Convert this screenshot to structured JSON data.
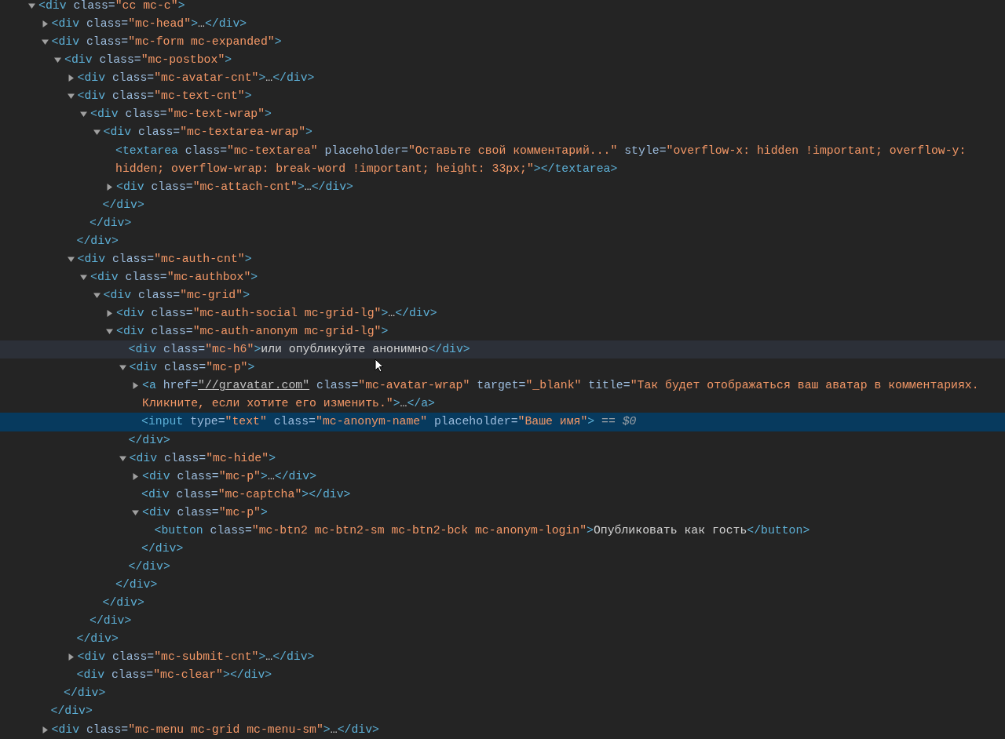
{
  "elements_tree": {
    "kind": "toggle",
    "expanded": true,
    "selected": false,
    "hovered": false,
    "line": "<div class=\"cc mc-c\">",
    "children": [
      {
        "kind": "toggle",
        "expanded": false,
        "selected": false,
        "hovered": false,
        "line": "<div class=\"mc-head\">…</div>"
      },
      {
        "kind": "toggle",
        "expanded": true,
        "selected": false,
        "hovered": false,
        "line": "<div class=\"mc-form mc-expanded\">",
        "close": "</div>",
        "children": [
          {
            "kind": "toggle",
            "expanded": true,
            "selected": false,
            "hovered": false,
            "line": "<div class=\"mc-postbox\">",
            "close": "</div>",
            "children": [
              {
                "kind": "toggle",
                "expanded": false,
                "selected": false,
                "hovered": false,
                "line": "<div class=\"mc-avatar-cnt\">…</div>"
              },
              {
                "kind": "toggle",
                "expanded": true,
                "selected": false,
                "hovered": false,
                "line": "<div class=\"mc-text-cnt\">",
                "close": "</div>",
                "children": [
                  {
                    "kind": "toggle",
                    "expanded": true,
                    "selected": false,
                    "hovered": false,
                    "line": "<div class=\"mc-text-wrap\">",
                    "close": "</div>",
                    "children": [
                      {
                        "kind": "toggle",
                        "expanded": true,
                        "selected": false,
                        "hovered": false,
                        "line": "<div class=\"mc-textarea-wrap\">",
                        "close": "</div>",
                        "children": [
                          {
                            "kind": "leaf",
                            "selected": false,
                            "hovered": false,
                            "line": "<textarea class=\"mc-textarea\" placeholder=\"Оставьте свой комментарий...\" style=\"overflow-x: hidden !important; overflow-y: hidden; overflow-wrap: break-word !important; height: 33px;\"></textarea>"
                          },
                          {
                            "kind": "toggle",
                            "expanded": false,
                            "selected": false,
                            "hovered": false,
                            "line": "<div class=\"mc-attach-cnt\">…</div>"
                          }
                        ]
                      }
                    ]
                  }
                ]
              },
              {
                "kind": "toggle",
                "expanded": true,
                "selected": false,
                "hovered": false,
                "line": "<div class=\"mc-auth-cnt\">",
                "close": "</div>",
                "children": [
                  {
                    "kind": "toggle",
                    "expanded": true,
                    "selected": false,
                    "hovered": false,
                    "line": "<div class=\"mc-authbox\">",
                    "close": "</div>",
                    "children": [
                      {
                        "kind": "toggle",
                        "expanded": true,
                        "selected": false,
                        "hovered": false,
                        "line": "<div class=\"mc-grid\">",
                        "close": "</div>",
                        "children": [
                          {
                            "kind": "toggle",
                            "expanded": false,
                            "selected": false,
                            "hovered": false,
                            "line": "<div class=\"mc-auth-social mc-grid-lg\">…</div>"
                          },
                          {
                            "kind": "toggle",
                            "expanded": true,
                            "selected": false,
                            "hovered": false,
                            "line": "<div class=\"mc-auth-anonym mc-grid-lg\">",
                            "close": "</div>",
                            "children": [
                              {
                                "kind": "leaf",
                                "selected": false,
                                "hovered": true,
                                "line": "<div class=\"mc-h6\">или опубликуйте анонимно</div>"
                              },
                              {
                                "kind": "toggle",
                                "expanded": true,
                                "selected": false,
                                "hovered": false,
                                "line": "<div class=\"mc-p\">",
                                "close": "</div>",
                                "children": [
                                  {
                                    "kind": "toggle",
                                    "expanded": false,
                                    "selected": false,
                                    "hovered": false,
                                    "href_link": true,
                                    "line": "<a href=\"//gravatar.com\" class=\"mc-avatar-wrap\" target=\"_blank\" title=\"Так будет отображаться ваш аватар в комментариях. Кликните, если хотите его изменить.\">…</a>"
                                  },
                                  {
                                    "kind": "leaf",
                                    "selected": true,
                                    "hovered": false,
                                    "line": "<input type=\"text\" class=\"mc-anonym-name\" placeholder=\"Ваше имя\">",
                                    "suffix": "== $0"
                                  }
                                ]
                              },
                              {
                                "kind": "toggle",
                                "expanded": true,
                                "selected": false,
                                "hovered": false,
                                "line": "<div class=\"mc-hide\">",
                                "close": "</div>",
                                "children": [
                                  {
                                    "kind": "toggle",
                                    "expanded": false,
                                    "selected": false,
                                    "hovered": false,
                                    "line": "<div class=\"mc-p\">…</div>"
                                  },
                                  {
                                    "kind": "leaf",
                                    "selected": false,
                                    "hovered": false,
                                    "line": "<div class=\"mc-captcha\"></div>"
                                  },
                                  {
                                    "kind": "toggle",
                                    "expanded": true,
                                    "selected": false,
                                    "hovered": false,
                                    "line": "<div class=\"mc-p\">",
                                    "close": "</div>",
                                    "children": [
                                      {
                                        "kind": "leaf",
                                        "selected": false,
                                        "hovered": false,
                                        "line": "<button class=\"mc-btn2 mc-btn2-sm mc-btn2-bck mc-anonym-login\">Опубликовать как гость</button>"
                                      }
                                    ]
                                  }
                                ]
                              }
                            ]
                          }
                        ]
                      }
                    ]
                  }
                ]
              },
              {
                "kind": "toggle",
                "expanded": false,
                "selected": false,
                "hovered": false,
                "line": "<div class=\"mc-submit-cnt\">…</div>"
              },
              {
                "kind": "leaf",
                "selected": false,
                "hovered": false,
                "line": "<div class=\"mc-clear\"></div>"
              }
            ]
          }
        ]
      },
      {
        "kind": "toggle",
        "expanded": false,
        "selected": false,
        "hovered": false,
        "line": "<div class=\"mc-menu mc-grid mc-menu-sm\">…</div>"
      }
    ]
  }
}
